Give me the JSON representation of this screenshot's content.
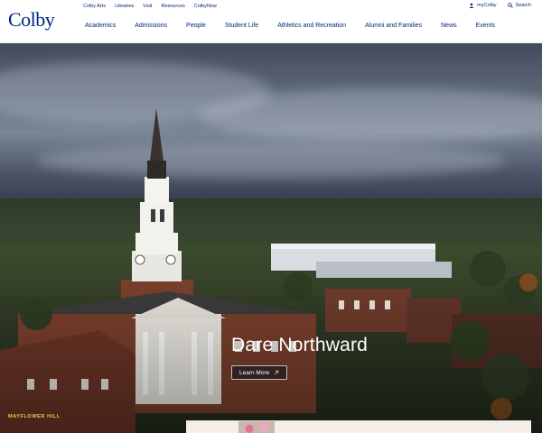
{
  "brand": {
    "logo_text": "Colby"
  },
  "utility_nav": {
    "left": [
      "Colby Arts",
      "Libraries",
      "Visit",
      "Resources",
      "ColbyNow"
    ],
    "my_colby": "myColby",
    "search": "Search"
  },
  "main_nav": [
    "Academics",
    "Admissions",
    "People",
    "Student Life",
    "Athletics and Recreation",
    "Alumni and Families",
    "News",
    "Events"
  ],
  "hero": {
    "headline": "Dare Northward",
    "cta_label": "Learn More",
    "caption": "MAYFLOWER HILL"
  },
  "colors": {
    "brand_navy": "#002878",
    "caption_gold": "#f2c94c"
  },
  "icons": [
    "user-icon",
    "search-icon",
    "external-arrow-icon"
  ]
}
